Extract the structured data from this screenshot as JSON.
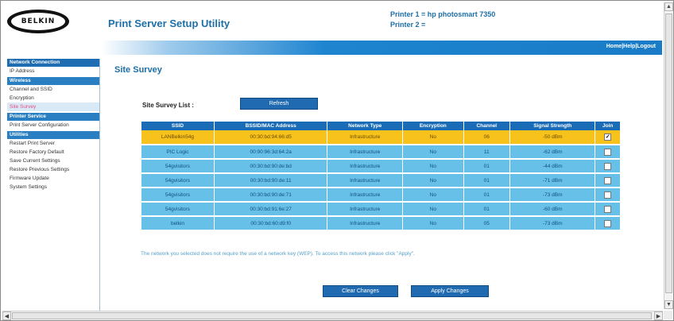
{
  "header": {
    "logo_text": "BELKIN",
    "app_title": "Print Server Setup Utility",
    "printer1": "Printer 1 = hp photosmart 7350",
    "printer2": "Printer 2 =",
    "links": "Home|Help|Logout"
  },
  "sidebar": [
    {
      "type": "head",
      "label": "Network Connection"
    },
    {
      "type": "item",
      "label": "IP Address"
    },
    {
      "type": "head",
      "label": "Wireless"
    },
    {
      "type": "item",
      "label": "Channel and SSID"
    },
    {
      "type": "item",
      "label": "Encryption"
    },
    {
      "type": "item",
      "label": "Site Survey",
      "active": true
    },
    {
      "type": "head",
      "label": "Printer Service"
    },
    {
      "type": "item",
      "label": "Print Server Configuration"
    },
    {
      "type": "head",
      "label": "Utilities"
    },
    {
      "type": "item",
      "label": "Restart Print Server"
    },
    {
      "type": "item",
      "label": "Restore Factory Default"
    },
    {
      "type": "item",
      "label": "Save Current Settings"
    },
    {
      "type": "item",
      "label": "Restore Previous Settings"
    },
    {
      "type": "item",
      "label": "Firmware Update"
    },
    {
      "type": "item",
      "label": "System Settings"
    }
  ],
  "main": {
    "page_title": "Site Survey",
    "survey_label": "Site Survey List :",
    "refresh_label": "Refresh",
    "columns": [
      "SSID",
      "BSSID/MAC Address",
      "Network Type",
      "Encryption",
      "Channel",
      "Signal Strength",
      "Join"
    ],
    "rows": [
      {
        "ssid": "LANBelkin54g",
        "bssid": "00:30:bd:94:66:d5",
        "type": "Infrastructure",
        "enc": "No",
        "channel": "06",
        "signal": "-50 dBm",
        "join": true
      },
      {
        "ssid": "PIC Logic",
        "bssid": "00:90:96:3d:64:2a",
        "type": "Infrastructure",
        "enc": "No",
        "channel": "11",
        "signal": "-62 dBm",
        "join": false
      },
      {
        "ssid": "54gvisitors",
        "bssid": "00:30:bd:90:de:bd",
        "type": "Infrastructure",
        "enc": "No",
        "channel": "01",
        "signal": "-44 dBm",
        "join": false
      },
      {
        "ssid": "54gvisitors",
        "bssid": "00:30:bd:90:de:11",
        "type": "Infrastructure",
        "enc": "No",
        "channel": "01",
        "signal": "-71 dBm",
        "join": false
      },
      {
        "ssid": "54gvisitors",
        "bssid": "00:30:bd:90:de:71",
        "type": "Infrastructure",
        "enc": "No",
        "channel": "01",
        "signal": "-73 dBm",
        "join": false
      },
      {
        "ssid": "54gvisitors",
        "bssid": "00:30:bd:91:6e:27",
        "type": "Infrastructure",
        "enc": "No",
        "channel": "01",
        "signal": "-60 dBm",
        "join": false
      },
      {
        "ssid": "belkin",
        "bssid": "00:30:bd:60:d9:f0",
        "type": "Infrastructure",
        "enc": "No",
        "channel": "05",
        "signal": "-73 dBm",
        "join": false
      }
    ],
    "note": "The network you selected does not require the use of a network key (WEP). To access this network please click \"Apply\".",
    "clear_label": "Clear Changes",
    "apply_label": "Apply Changes"
  },
  "colors": {
    "accent": "#1d6fa8",
    "table_header": "#1b6cb7",
    "row_bg": "#66c0e8",
    "selected_row": "#f7c21c"
  },
  "icons": {
    "scroll_up": "arrow-up-icon",
    "scroll_down": "arrow-down-icon",
    "scroll_left": "arrow-left-icon",
    "scroll_right": "arrow-right-icon"
  }
}
